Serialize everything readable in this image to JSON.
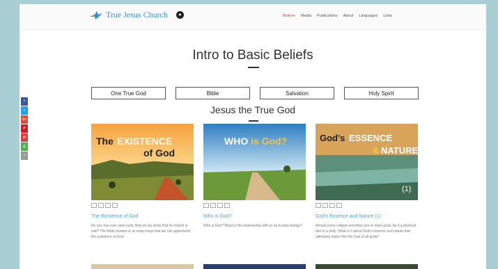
{
  "header": {
    "logo_text": "True Jesus Church",
    "nav": [
      "Believe",
      "Media",
      "Publications",
      "About",
      "Languages",
      "Links"
    ]
  },
  "page_title": "Intro to Basic Beliefs",
  "tabs": [
    "One True God",
    "Bible",
    "Salvation",
    "Holy Spirit"
  ],
  "section_title": "Jesus the True God",
  "cards": [
    {
      "image_line1a": "The",
      "image_line1b": "EXISTENCE",
      "image_line2": "of God",
      "title": "The Existence of God",
      "desc": "No one has ever seen God. How do we know that he indeed is real? The Bible reveals to us many ways that we can apprehend the existence of God."
    },
    {
      "image_line1a": "WHO",
      "image_line1b": "is God?",
      "title": "Who is God?",
      "desc": "Who is God? What is His relationship with us as human beings?"
    },
    {
      "image_line1a": "God's",
      "image_line1b": "ESSENCE",
      "image_line2a": "&",
      "image_line2b": "NATURE",
      "image_num": "(1)",
      "title": "God's Essence and Nature (1)",
      "desc": "Almost every religion worships one or more gods, be it a physical idol or a deity. What is it about God's essence and nature that ultimately make Him the God of all gods?"
    }
  ],
  "share": [
    "f",
    "t",
    "G+",
    "P",
    "✉",
    "⎙",
    "+"
  ],
  "colors": {
    "accent": "#4aa3df",
    "nav_active": "#d9423c",
    "orange": "#f3a44a",
    "yellow": "#f5c342"
  }
}
